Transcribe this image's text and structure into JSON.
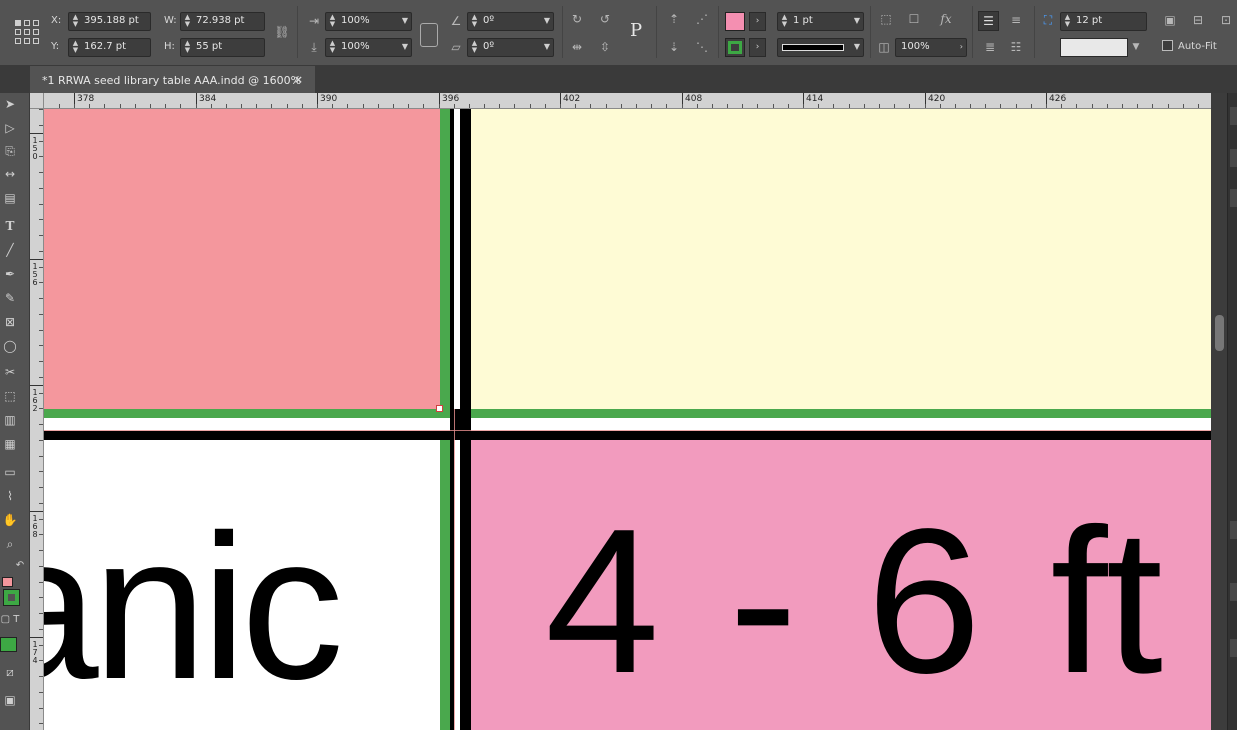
{
  "control_panel": {
    "x_label": "X:",
    "x_value": "395.188 pt",
    "y_label": "Y:",
    "y_value": "162.7 pt",
    "w_label": "W:",
    "w_value": "72.938 pt",
    "h_label": "H:",
    "h_value": "55 pt",
    "scale_x": "100%",
    "scale_y": "100%",
    "rotation": "0º",
    "shear": "0º",
    "stroke_weight": "1 pt",
    "opacity": "100%",
    "text_frame_gutter": "12 pt",
    "autofit_label": "Auto-Fit",
    "fill_color": "#f48fb1",
    "stroke_color": "#3da844"
  },
  "document_tab": {
    "title": "*1 RRWA seed library table AAA.indd @ 1600%",
    "close": "×"
  },
  "ruler": {
    "h_labels": [
      "378",
      "384",
      "390",
      "396",
      "402",
      "408",
      "414",
      "420",
      "426"
    ],
    "v_labels": [
      "150",
      "156",
      "162",
      "168",
      "174"
    ]
  },
  "canvas": {
    "cell_bottom_left_text": "anic",
    "cell_bottom_right_text": "4 - 6 ft",
    "colors": {
      "pink_top": "#f4979d",
      "yellow_top": "#fefbd5",
      "pink_bottom": "#f29bbe",
      "stroke_green": "#4aa84d",
      "black": "#000000",
      "white": "#ffffff"
    }
  }
}
